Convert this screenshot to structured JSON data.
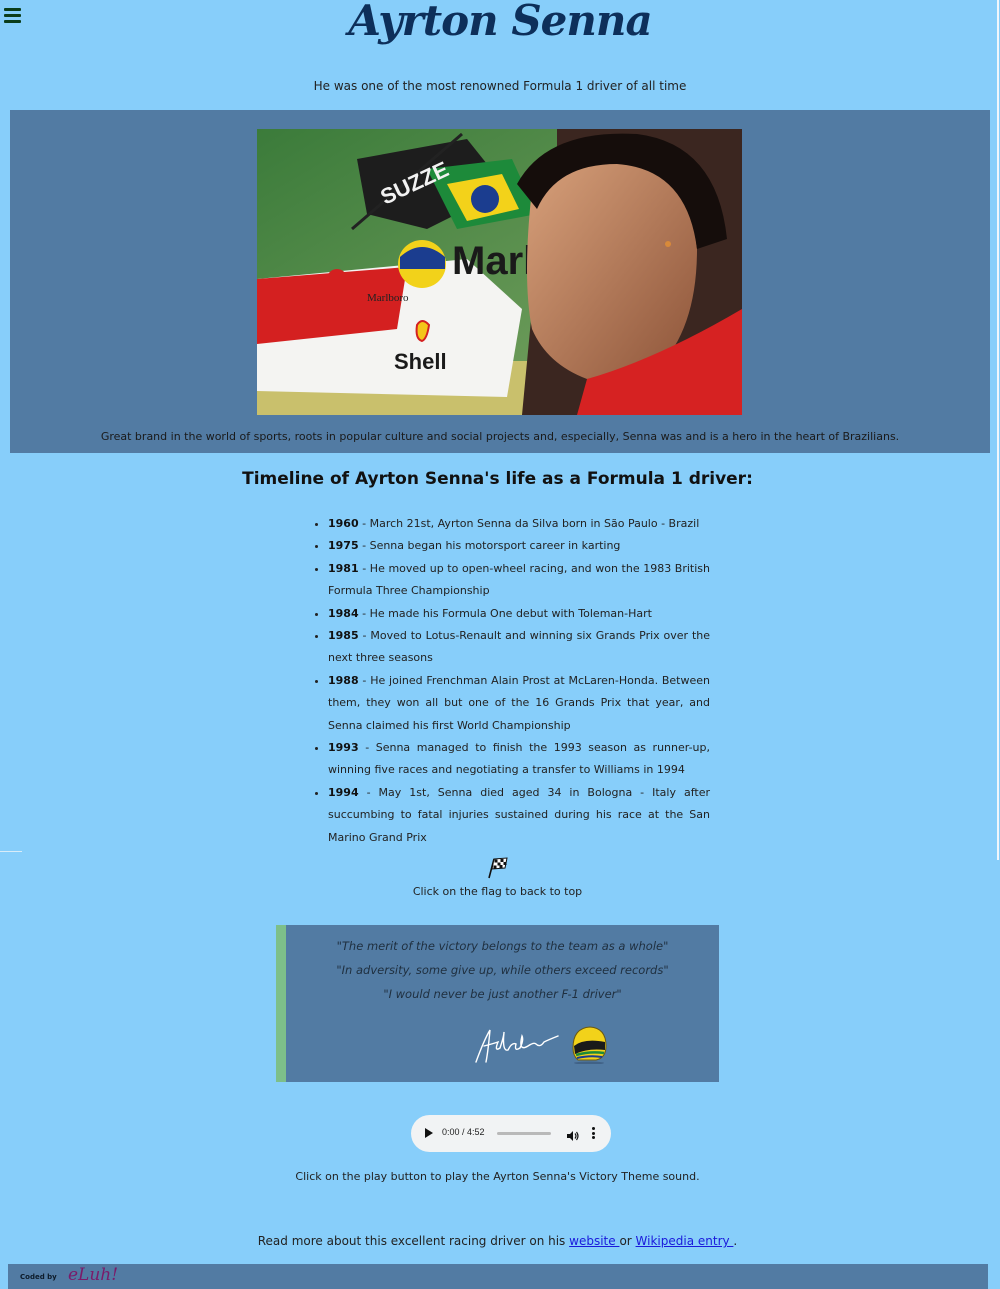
{
  "header": {
    "menu_icon": "hamburger-icon",
    "title": "Ayrton Senna",
    "subtitle": "He was one of the most renowned Formula 1 driver of all time"
  },
  "hero": {
    "caption": "Great brand in the world of sports, roots in popular culture and social projects and, especially, Senna was and is a hero in the heart of Brazilians.",
    "photo_texts": [
      "SUZZE",
      "Marl",
      "Marlboro",
      "Shell"
    ]
  },
  "timeline": {
    "heading": "Timeline of Ayrton Senna's life as a Formula 1 driver:",
    "items": [
      {
        "year": "1960",
        "text": " - March 21st, Ayrton Senna da Silva born in São Paulo - Brazil"
      },
      {
        "year": "1975",
        "text": " - Senna began his motorsport career in karting"
      },
      {
        "year": "1981",
        "text": " - He moved up to open-wheel racing, and won the 1983 British Formula Three Championship"
      },
      {
        "year": "1984",
        "text": " - He made his Formula One debut with Toleman-Hart"
      },
      {
        "year": "1985",
        "text": " - Moved to Lotus-Renault and winning six Grands Prix over the next three seasons"
      },
      {
        "year": "1988",
        "text": " - He joined Frenchman Alain Prost at McLaren-Honda. Between them, they won all but one of the 16 Grands Prix that year, and Senna claimed his first World Championship"
      },
      {
        "year": "1993",
        "text": " - Senna managed to finish the 1993 season as runner-up, winning five races and negotiating a transfer to Williams in 1994"
      },
      {
        "year": "1994",
        "text": " - May 1st, Senna died aged 34 in Bologna - Italy after succumbing to fatal injuries sustained during his race at the San Marino Grand Prix"
      }
    ]
  },
  "back_to_top": {
    "icon": "checkered-flag-icon",
    "label": "Click on the flag to back to top"
  },
  "quotes": {
    "lines": [
      "\"The merit of the victory belongs to the team as a whole\"",
      "\"In adversity, some give up, while others exceed records\"",
      "\"I would never be just another F-1 driver\""
    ],
    "signature_text": "Ayrton Senna"
  },
  "audio": {
    "time": "0:00 / 4:52",
    "progress": 0,
    "note": "Click on the play button to play the Ayrton Senna's Victory Theme sound."
  },
  "read_more": {
    "prefix": "Read more about this excellent racing driver on his ",
    "website_label": "website ",
    "middle": "or ",
    "wikipedia_label": "Wikipedia entry ",
    "suffix": "."
  },
  "footer": {
    "coded_by": "Coded by",
    "logo_text": "eLuh!"
  },
  "colors": {
    "page_bg": "#87cefa",
    "panel_bg": "#527ba3",
    "title": "#0d2f5a",
    "quote_accent": "#7dbf8a",
    "link": "#1a1adb"
  }
}
